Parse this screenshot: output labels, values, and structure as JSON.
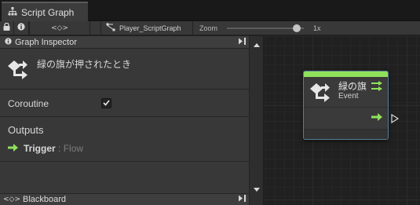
{
  "window": {
    "tab_title": "Script Graph"
  },
  "toolbar": {
    "nav_symbol": "<◇>",
    "graph_name": "Player_ScriptGraph",
    "zoom_label": "Zoom",
    "zoom_value": "1x",
    "zoom_fraction": 0.95
  },
  "inspector": {
    "header_title": "Graph Inspector",
    "event_title": "緑の旗が押されたとき",
    "coroutine_label": "Coroutine",
    "coroutine_checked": true,
    "outputs_title": "Outputs",
    "output_name": "Trigger",
    "output_separator": " : ",
    "output_type": "Flow"
  },
  "blackboard": {
    "title": "Blackboard",
    "icon_text": "<◇>"
  },
  "node": {
    "title": "緑の旗",
    "subtitle": "Event",
    "accent_color": "#8fe15c",
    "border_color": "#5a7c94"
  },
  "icons": {
    "hierarchy": "hierarchy-icon",
    "lock": "lock-icon",
    "info": "info-icon",
    "graph": "graph-icon",
    "event": "event-flow-icon",
    "arrow": "flow-arrow-icon",
    "collapse": "collapse-panel-icon"
  }
}
